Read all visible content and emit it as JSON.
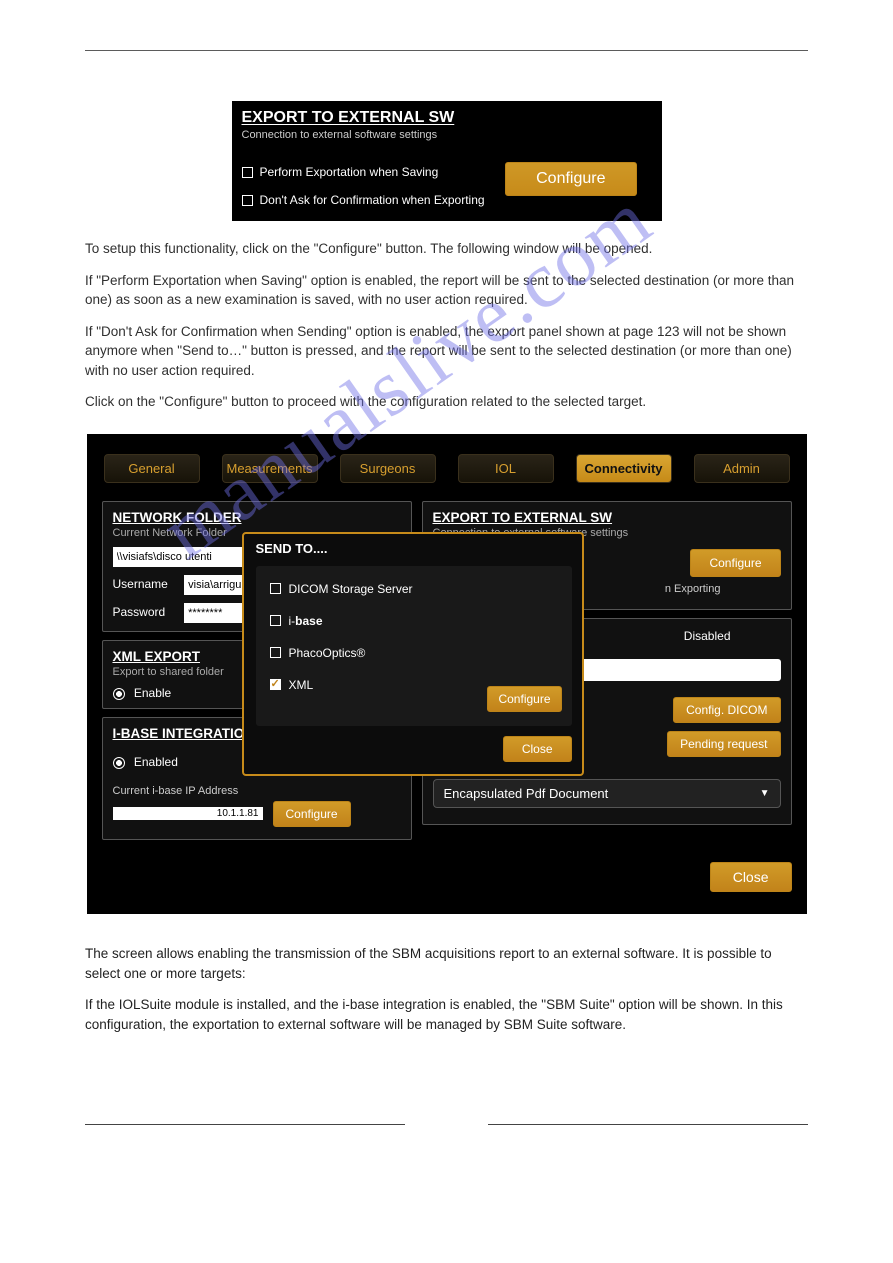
{
  "panel1": {
    "title": "EXPORT TO EXTERNAL SW",
    "subtitle": "Connection to external software settings",
    "cb1": "Perform Exportation when Saving",
    "cb2": "Don't Ask for Confirmation when Exporting",
    "configure": "Configure"
  },
  "body": {
    "p1": "To setup this functionality, click on the \"Configure\" button. The following window will be opened.",
    "p2": "If \"Perform Exportation when Saving\" option is enabled, the report will be sent to the selected destination (or more than one) as soon as a new examination is saved, with no user action required.",
    "p3": "If \"Don't Ask for Confirmation when Sending\" option is enabled, the export panel shown at page 123 will not be shown anymore when \"Send to…\" button is pressed, and the report will be sent to the selected destination (or more than one) with no user action required.",
    "p4": "Click on the \"Configure\" button to proceed with the configuration related to the selected target."
  },
  "panel2": {
    "tabs": [
      "General",
      "Measurements",
      "Surgeons",
      "IOL",
      "Connectivity",
      "Admin"
    ],
    "activeTabIndex": 4,
    "network": {
      "title": "NETWORK FOLDER",
      "sub": "Current Network Folder",
      "folder": "\\\\visiafs\\disco utenti",
      "username_lbl": "Username",
      "username_val": "visia\\arrigu",
      "password_lbl": "Password",
      "password_val": "********"
    },
    "xml": {
      "title": "XML EXPORT",
      "sub": "Export to shared folder",
      "enable": "Enable"
    },
    "ibase": {
      "title": "I-BASE INTEGRATION",
      "enabled": "Enabled",
      "ip_lbl": "Current i-base IP Address",
      "ip": "10.1.1.81",
      "configure": "Configure"
    },
    "ext": {
      "title": "EXPORT TO EXTERNAL SW",
      "sub": "Connection to external software settings",
      "disabled": "Disabled",
      "configure": "Configure",
      "config_dicom": "Config. DICOM",
      "pending": "Pending request",
      "dropdown": "Encapsulated Pdf Document"
    },
    "close": "Close"
  },
  "modal": {
    "title": "SEND TO....",
    "opts": [
      "DICOM Storage Server",
      "i-base",
      "PhacoOptics®",
      "XML"
    ],
    "checkedIndex": 3,
    "configure": "Configure",
    "close": "Close"
  },
  "after": {
    "p1": "The screen allows enabling the transmission of the SBM acquisitions report to an external software. It is possible to select one or more targets:",
    "p2": "If the IOLSuite module is installed, and the i-base integration is enabled, the \"SBM Suite\" option will be shown. In this configuration, the exportation to external software will be managed by SBM Suite software."
  },
  "watermark": "manualslive.com"
}
